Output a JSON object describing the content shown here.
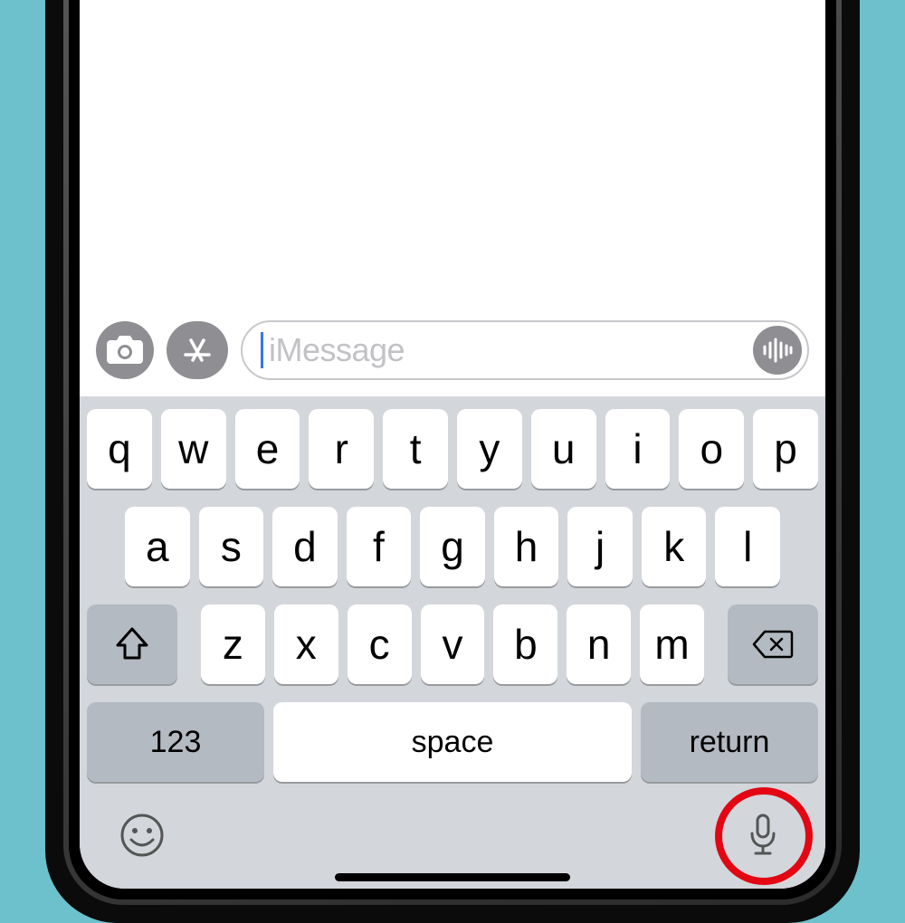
{
  "input": {
    "placeholder": "iMessage"
  },
  "keyboard": {
    "row1": [
      "q",
      "w",
      "e",
      "r",
      "t",
      "y",
      "u",
      "i",
      "o",
      "p"
    ],
    "row2": [
      "a",
      "s",
      "d",
      "f",
      "g",
      "h",
      "j",
      "k",
      "l"
    ],
    "row3": [
      "z",
      "x",
      "c",
      "v",
      "b",
      "n",
      "m"
    ],
    "numeric_label": "123",
    "space_label": "space",
    "return_label": "return"
  },
  "colors": {
    "background": "#6cc1cc",
    "keyboard_bg": "#d3d7dc",
    "key_bg": "#ffffff",
    "fn_key_bg": "#b4bac1",
    "highlight": "#e30613"
  }
}
